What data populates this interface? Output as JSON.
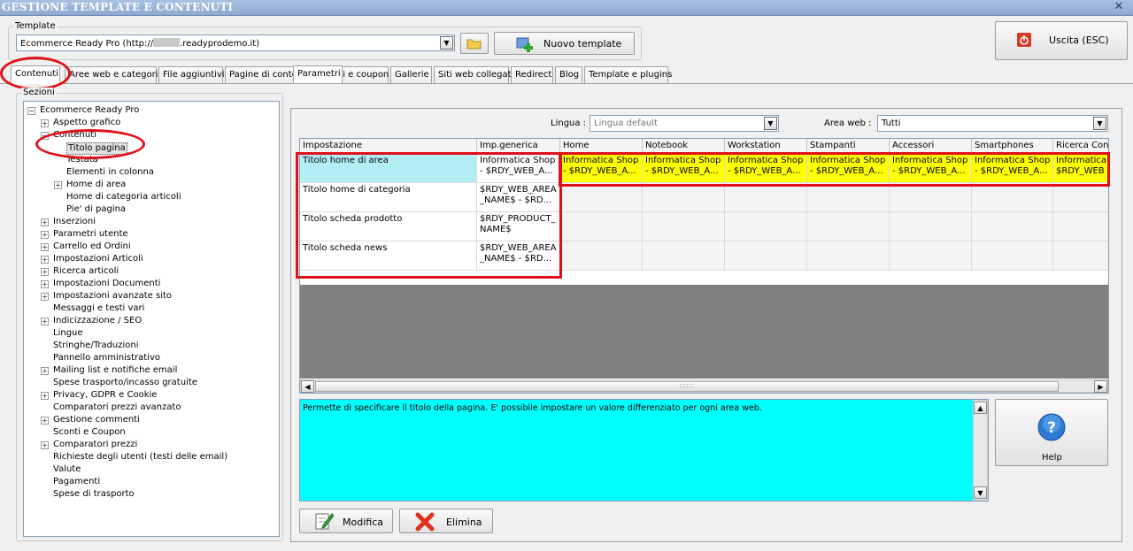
{
  "window": {
    "title": "GESTIONE TEMPLATE E CONTENUTI",
    "close_glyph": "✕"
  },
  "template_group": {
    "label": "Template",
    "selected_prefix": "Ecommerce Ready Pro (http://",
    "selected_suffix": ".readyprodemo.it)",
    "new_template_label": "Nuovo template"
  },
  "exit_button": {
    "label": "Uscita (ESC)"
  },
  "tabs": [
    {
      "label": "Contenuti"
    },
    {
      "label": "Aree web e categorie"
    },
    {
      "label": "File aggiuntivi"
    },
    {
      "label": "Pagine di contenuti"
    },
    {
      "label": "Sconti e coupon"
    },
    {
      "label": "Gallerie"
    },
    {
      "label": "Siti web collegati"
    },
    {
      "label": "Redirect"
    },
    {
      "label": "Blog"
    },
    {
      "label": "Template e plugins"
    }
  ],
  "sections": {
    "label": "Sezioni",
    "tree": [
      {
        "label": "Ecommerce Ready Pro",
        "exp": "−"
      },
      {
        "label": "Aspetto grafico",
        "exp": "+"
      },
      {
        "label": "Contenuti",
        "exp": "−"
      },
      {
        "label": "Titolo pagina",
        "exp": ""
      },
      {
        "label": "Testata",
        "exp": ""
      },
      {
        "label": "Elementi in colonna",
        "exp": ""
      },
      {
        "label": "Home di area",
        "exp": "+"
      },
      {
        "label": "Home di categoria articoli",
        "exp": ""
      },
      {
        "label": "Pie' di pagina",
        "exp": ""
      },
      {
        "label": "Inserzioni",
        "exp": "+"
      },
      {
        "label": "Parametri utente",
        "exp": "+"
      },
      {
        "label": "Carrello ed Ordini",
        "exp": "+"
      },
      {
        "label": "Impostazioni Articoli",
        "exp": "+"
      },
      {
        "label": "Ricerca articoli",
        "exp": "+"
      },
      {
        "label": "Impostazioni Documenti",
        "exp": "+"
      },
      {
        "label": "Impostazioni avanzate sito",
        "exp": "+"
      },
      {
        "label": "Messaggi e testi vari",
        "exp": ""
      },
      {
        "label": "Indicizzazione / SEO",
        "exp": "+"
      },
      {
        "label": "Lingue",
        "exp": ""
      },
      {
        "label": "Stringhe/Traduzioni",
        "exp": ""
      },
      {
        "label": "Pannello amministrativo",
        "exp": ""
      },
      {
        "label": "Mailing list e notifiche email",
        "exp": "+"
      },
      {
        "label": "Spese trasporto/incasso gratuite",
        "exp": ""
      },
      {
        "label": "Privacy, GDPR e Cookie",
        "exp": "+"
      },
      {
        "label": "Comparatori prezzi avanzato",
        "exp": ""
      },
      {
        "label": "Gestione commenti",
        "exp": "+"
      },
      {
        "label": "Sconti e Coupon",
        "exp": ""
      },
      {
        "label": "Comparatori prezzi",
        "exp": "+"
      },
      {
        "label": "Richieste degli utenti (testi delle email)",
        "exp": ""
      },
      {
        "label": "Valute",
        "exp": ""
      },
      {
        "label": "Pagamenti",
        "exp": ""
      },
      {
        "label": "Spese di trasporto",
        "exp": ""
      }
    ]
  },
  "params_tab": {
    "label": "Parametri"
  },
  "filters": {
    "lingua_label": "Lingua :",
    "lingua_value": "Lingua default",
    "area_label": "Area web :",
    "area_value": "Tutti"
  },
  "grid": {
    "headers": [
      "Impostazione",
      "Imp.generica",
      "Home",
      "Notebook",
      "Workstation",
      "Stampanti",
      "Accessori",
      "Smartphones",
      "Ricerca Cons"
    ],
    "rows": [
      {
        "name": "Titolo home di area",
        "generic": "Informatica Shop - $RDY_WEB_A...",
        "areas": [
          "Informatica Shop - $RDY_WEB_A...",
          "Informatica Shop - $RDY_WEB_A...",
          "Informatica Shop - $RDY_WEB_A...",
          "Informatica Shop - $RDY_WEB_A...",
          "Informatica Shop - $RDY_WEB_A...",
          "Informatica Shop - $RDY_WEB_A...",
          "Informatica - $RDY_WEB"
        ]
      },
      {
        "name": "Titolo home di categoria",
        "generic": "$RDY_WEB_AREA_NAME$ - $RD...",
        "areas": [
          "",
          "",
          "",
          "",
          "",
          "",
          ""
        ]
      },
      {
        "name": "Titolo scheda prodotto",
        "generic": "$RDY_PRODUCT_NAME$",
        "areas": [
          "",
          "",
          "",
          "",
          "",
          "",
          ""
        ]
      },
      {
        "name": "Titolo scheda news",
        "generic": "$RDY_WEB_AREA_NAME$ - $RD...",
        "areas": [
          "",
          "",
          "",
          "",
          "",
          "",
          ""
        ]
      }
    ],
    "scroll_grip": "::::::",
    "highlight_color": "#ffff00",
    "selected_color": "#b3eef4"
  },
  "description": {
    "text": "Permette di specificare il titolo della pagina. E' possibile impostare un valore differenziato per ogni area web.",
    "bg": "#00ffff"
  },
  "actions": {
    "modify_label": "Modifica",
    "delete_label": "Elimina",
    "help_label": "Help"
  },
  "icons": {
    "folder": "folder-icon",
    "add": "add-template-icon",
    "exit": "power-icon",
    "help": "help-icon",
    "edit": "edit-icon",
    "delete": "delete-icon"
  }
}
